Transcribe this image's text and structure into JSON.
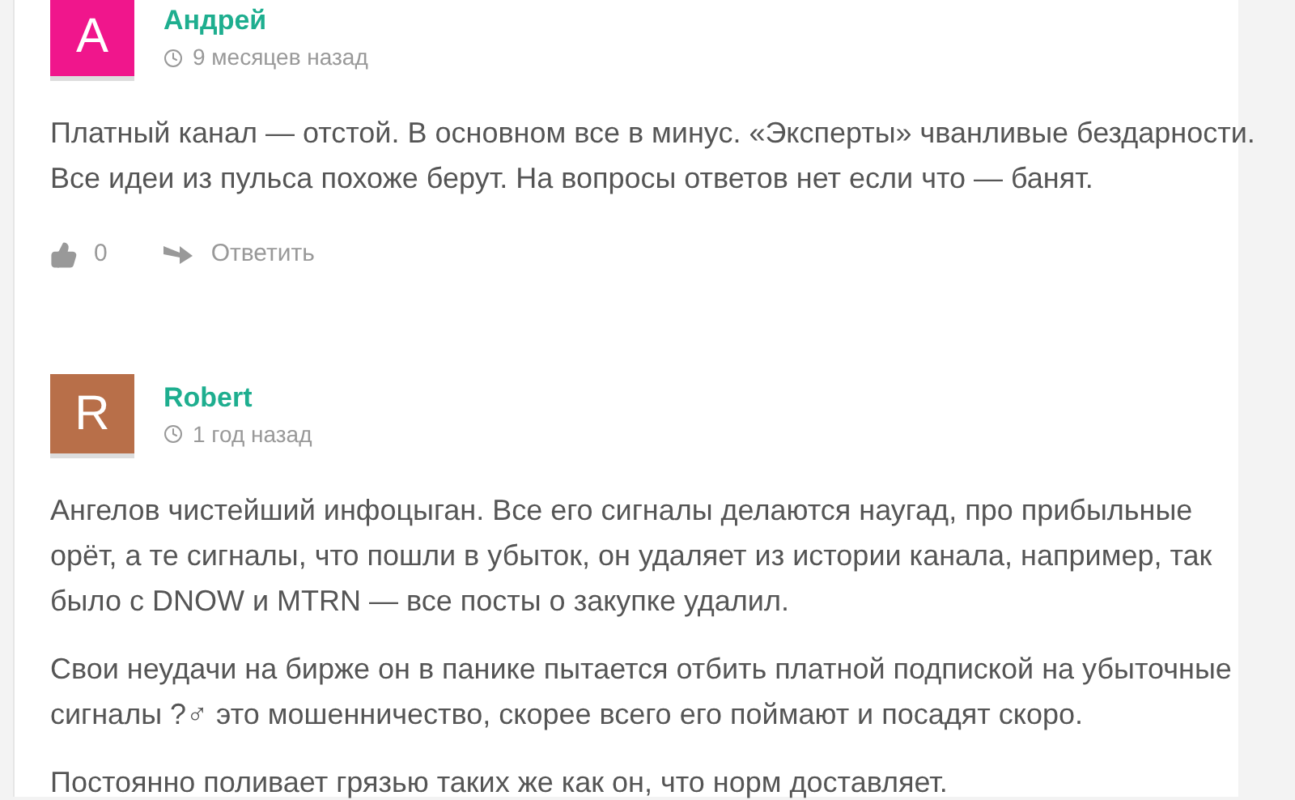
{
  "comments": [
    {
      "initial": "A",
      "color": "#f0168c",
      "author": "Андрей",
      "time": "9 месяцев назад",
      "paragraphs": [
        [
          "Платный канал — отстой. В основном все в минус. «Эксперты» чванливые бездарности.",
          "Все идеи из пульса похоже берут. На вопросы ответов нет если что — банят."
        ]
      ],
      "likes": "0",
      "reply": "Ответить"
    },
    {
      "initial": "R",
      "color": "#b86f49",
      "author": "Robert",
      "time": "1 год назад",
      "paragraphs": [
        [
          "Ангелов чистейший инфоцыган. Все его сигналы делаются наугад, про прибыльные",
          "орёт, а те сигналы, что пошли в убыток, он удаляет из истории канала, например, так",
          "было с DNOW и MTRN — все посты о закупке удалил."
        ],
        [
          "Свои неудачи на бирже он в панике пытается отбить платной подпиской на убыточные",
          "сигналы ?♂ это мошенничество, скорее всего его поймают и посадят скоро."
        ],
        [
          "Постоянно поливает грязью таких же как он, что норм доставляет."
        ]
      ]
    }
  ]
}
